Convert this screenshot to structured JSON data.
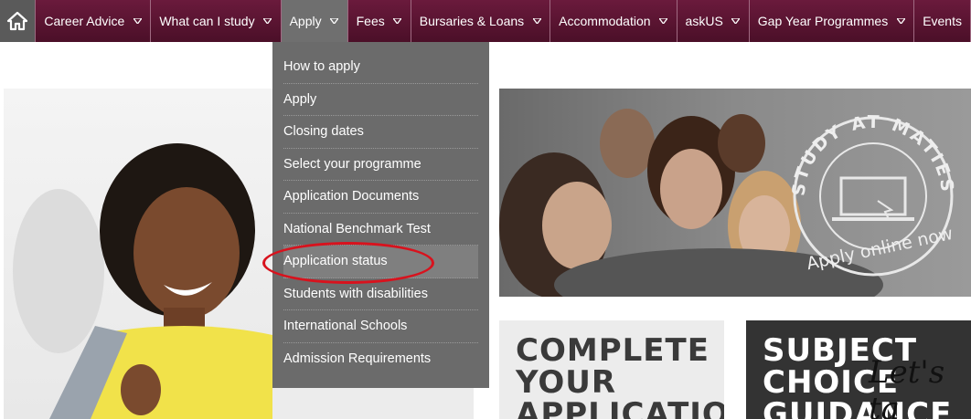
{
  "nav": {
    "items": [
      {
        "label": "Career Advice",
        "caret": true
      },
      {
        "label": "What can I study",
        "caret": true
      },
      {
        "label": "Apply",
        "caret": true
      },
      {
        "label": "Fees",
        "caret": true
      },
      {
        "label": "Bursaries & Loans",
        "caret": true
      },
      {
        "label": "Accommodation",
        "caret": true
      },
      {
        "label": "askUS",
        "caret": true
      },
      {
        "label": "Gap Year Programmes",
        "caret": true
      },
      {
        "label": "Events",
        "caret": false
      }
    ],
    "active_index": 2
  },
  "dropdown": {
    "items": [
      "How to apply",
      "Apply",
      "Closing dates",
      "Select your programme",
      "Application Documents",
      "National Benchmark Test",
      "Application status",
      "Students with disabilities",
      "International Schools",
      "Admission Requirements"
    ],
    "highlighted": "Application status"
  },
  "banner": {
    "stamp_top": "STUDY AT MATIES",
    "stamp_bottom": "Apply online now"
  },
  "tiles": {
    "complete": [
      "COMPLETE",
      "YOUR",
      "APPLICATION"
    ],
    "subject": [
      "SUBJECT",
      "CHOICE",
      "GUIDANCE"
    ],
    "script": "Let's ta"
  },
  "colors": {
    "nav_bg": "#5a1430",
    "active_bg": "#6f6f6f",
    "dropdown_bg": "#6b6b6b",
    "annotation_red": "#d8121d"
  }
}
